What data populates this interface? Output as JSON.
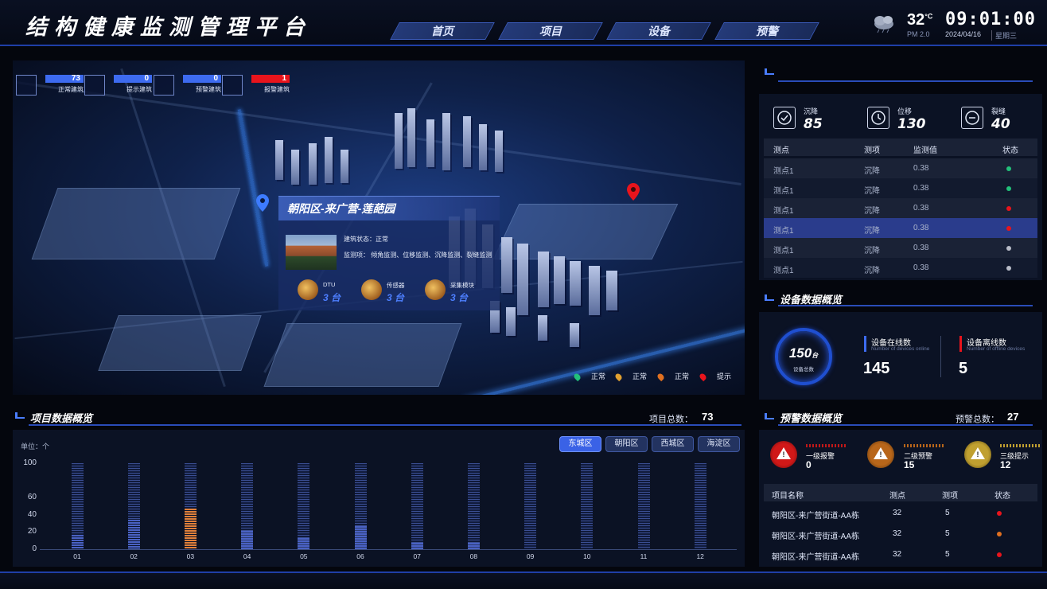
{
  "header": {
    "title": "结构健康监测管理平台",
    "nav": [
      "首页",
      "项目",
      "设备",
      "预警"
    ],
    "active_nav": 0,
    "temperature": "32",
    "temp_unit": "°C",
    "pm": "PM 2.0",
    "time": "09:01:00",
    "date": "2024/04/16",
    "weekday": "星期三"
  },
  "map": {
    "counters": [
      {
        "value": "73",
        "label": "正常建筑",
        "color": "#3d6bf0"
      },
      {
        "value": "0",
        "label": "提示建筑",
        "color": "#3d6bf0"
      },
      {
        "value": "0",
        "label": "预警建筑",
        "color": "#3d6bf0"
      },
      {
        "value": "1",
        "label": "报警建筑",
        "color": "#e8141c"
      }
    ],
    "popup": {
      "title": "朝阳区-来广营-莲葩园",
      "status": "建筑状态：正常",
      "items": "监测项：    倾角监测、位移监测、沉降监测、裂缝监测",
      "devices": [
        {
          "label": "DTU",
          "value": "3 台"
        },
        {
          "label": "传感器",
          "value": "3 台"
        },
        {
          "label": "采集模块",
          "value": "3 台"
        }
      ]
    },
    "legend": [
      {
        "label": "正常",
        "color": "#22c07a"
      },
      {
        "label": "正常",
        "color": "#e0a030"
      },
      {
        "label": "正常",
        "color": "#e07020"
      },
      {
        "label": "提示",
        "color": "#e8141c"
      }
    ]
  },
  "monitor": {
    "stats": [
      {
        "label": "沉降",
        "value": "85",
        "icon": "check-circle-icon"
      },
      {
        "label": "位移",
        "value": "130",
        "icon": "clock-icon"
      },
      {
        "label": "裂缝",
        "value": "40",
        "icon": "minus-circle-icon"
      }
    ],
    "columns": [
      "测点",
      "测项",
      "监测值",
      "状态"
    ],
    "rows": [
      {
        "point": "测点1",
        "item": "沉降",
        "value": "0.38",
        "status": "#22c07a"
      },
      {
        "point": "测点1",
        "item": "沉降",
        "value": "0.38",
        "status": "#22c07a"
      },
      {
        "point": "测点1",
        "item": "沉降",
        "value": "0.38",
        "status": "#e8141c"
      },
      {
        "point": "测点1",
        "item": "沉降",
        "value": "0.38",
        "status": "#e8141c"
      },
      {
        "point": "测点1",
        "item": "沉降",
        "value": "0.38",
        "status": "#b8bcc8"
      },
      {
        "point": "测点1",
        "item": "沉降",
        "value": "0.38",
        "status": "#b8bcc8"
      }
    ]
  },
  "device_overview": {
    "title": "设备数据概览",
    "total": "150",
    "total_unit": "台",
    "total_label": "设备总数",
    "online_label": "设备在线数",
    "online_sub": "Number of devices online",
    "online": "145",
    "offline_label": "设备离线数",
    "offline_sub": "Number of offline devices",
    "offline": "5"
  },
  "project_overview": {
    "title": "项目数据概览",
    "total_label": "项目总数：",
    "total": "73",
    "unit_label": "单位：个",
    "tabs": [
      "东城区",
      "朝阳区",
      "西城区",
      "海淀区"
    ],
    "active_tab": 0
  },
  "chart_data": {
    "type": "bar",
    "categories": [
      "01",
      "02",
      "03",
      "04",
      "05",
      "06",
      "07",
      "08",
      "09",
      "10",
      "11",
      "12"
    ],
    "values": [
      17,
      34,
      47,
      21,
      13,
      27,
      7,
      7,
      0,
      0,
      0,
      0
    ],
    "highlight_index": 2,
    "ylim": [
      0,
      100
    ],
    "yticks": [
      0,
      20,
      40,
      60,
      100
    ],
    "ylabel": "单位：个",
    "xlabel": "",
    "grid": false,
    "colors": {
      "normal": "#4a62c4",
      "highlight": "#e0803a"
    }
  },
  "alert_overview": {
    "title": "预警数据概览",
    "total_label": "预警总数：",
    "total": "27",
    "levels": [
      {
        "label": "一级报警",
        "value": "0",
        "color": "#c01818"
      },
      {
        "label": "二级预警",
        "value": "15",
        "color": "#b8661a"
      },
      {
        "label": "三级提示",
        "value": "12",
        "color": "#c0a030"
      }
    ],
    "columns": [
      "项目名称",
      "测点",
      "测项",
      "状态"
    ],
    "rows": [
      {
        "name": "朝阳区-来广营街道-AA栋",
        "points": "32",
        "items": "5",
        "status": "#e8141c"
      },
      {
        "name": "朝阳区-来广营街道-AA栋",
        "points": "32",
        "items": "5",
        "status": "#e07020"
      },
      {
        "name": "朝阳区-来广营街道-AA栋",
        "points": "32",
        "items": "5",
        "status": "#e8141c"
      }
    ]
  }
}
